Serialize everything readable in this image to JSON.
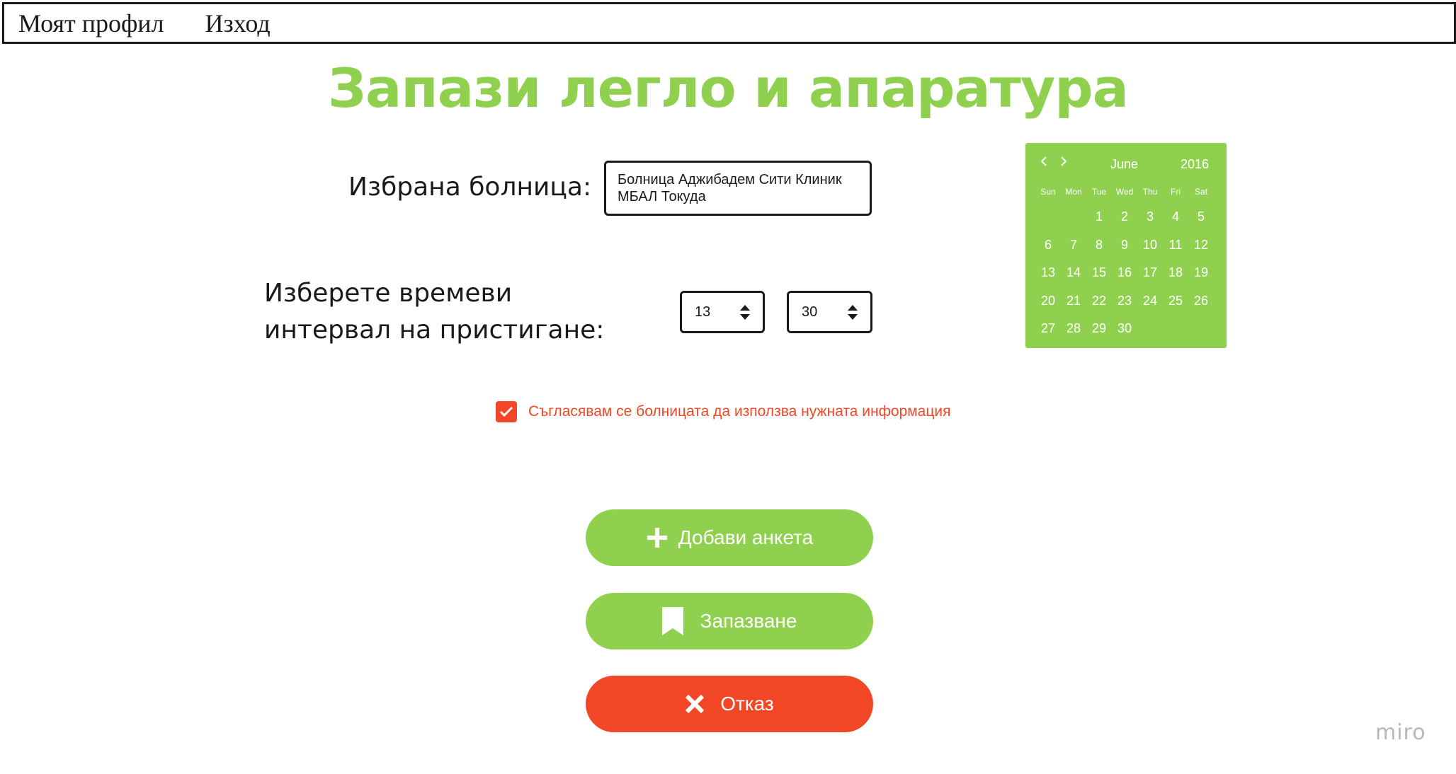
{
  "nav": {
    "profile": "Моят профил",
    "logout": "Изход"
  },
  "title": "Запази легло и апаратура",
  "hospital": {
    "label": "Избрана болница:",
    "line1": "Болница Аджибадем Сити Клиник",
    "line2": "МБАЛ Токуда"
  },
  "time": {
    "label_line1": "Изберете времеви",
    "label_line2": "интервал на пристигане:",
    "hour": "13",
    "minute": "30"
  },
  "calendar": {
    "prev_icon": "chevron-left-icon",
    "next_icon": "chevron-right-icon",
    "month": "June",
    "year": "2016",
    "weekdays": [
      "Sun",
      "Mon",
      "Tue",
      "Wed",
      "Thu",
      "Fri",
      "Sat"
    ],
    "days": [
      "",
      "",
      "1",
      "2",
      "3",
      "4",
      "5",
      "6",
      "7",
      "8",
      "9",
      "10",
      "11",
      "12",
      "13",
      "14",
      "15",
      "16",
      "17",
      "18",
      "19",
      "20",
      "21",
      "22",
      "23",
      "24",
      "25",
      "26",
      "27",
      "28",
      "29",
      "30",
      "",
      "",
      ""
    ]
  },
  "consent": {
    "checked": true,
    "text": "Съгласявам се болницата да използва нужната информация"
  },
  "buttons": {
    "add": {
      "label": "Добави анкета",
      "icon": "plus-icon"
    },
    "save": {
      "label": "Запазване",
      "icon": "bookmark-icon"
    },
    "cancel": {
      "label": "Отказ",
      "icon": "close-icon"
    }
  },
  "colors": {
    "green": "#8fd14f",
    "red": "#f24726",
    "dark": "#1a1a1a"
  },
  "watermark": "miro"
}
